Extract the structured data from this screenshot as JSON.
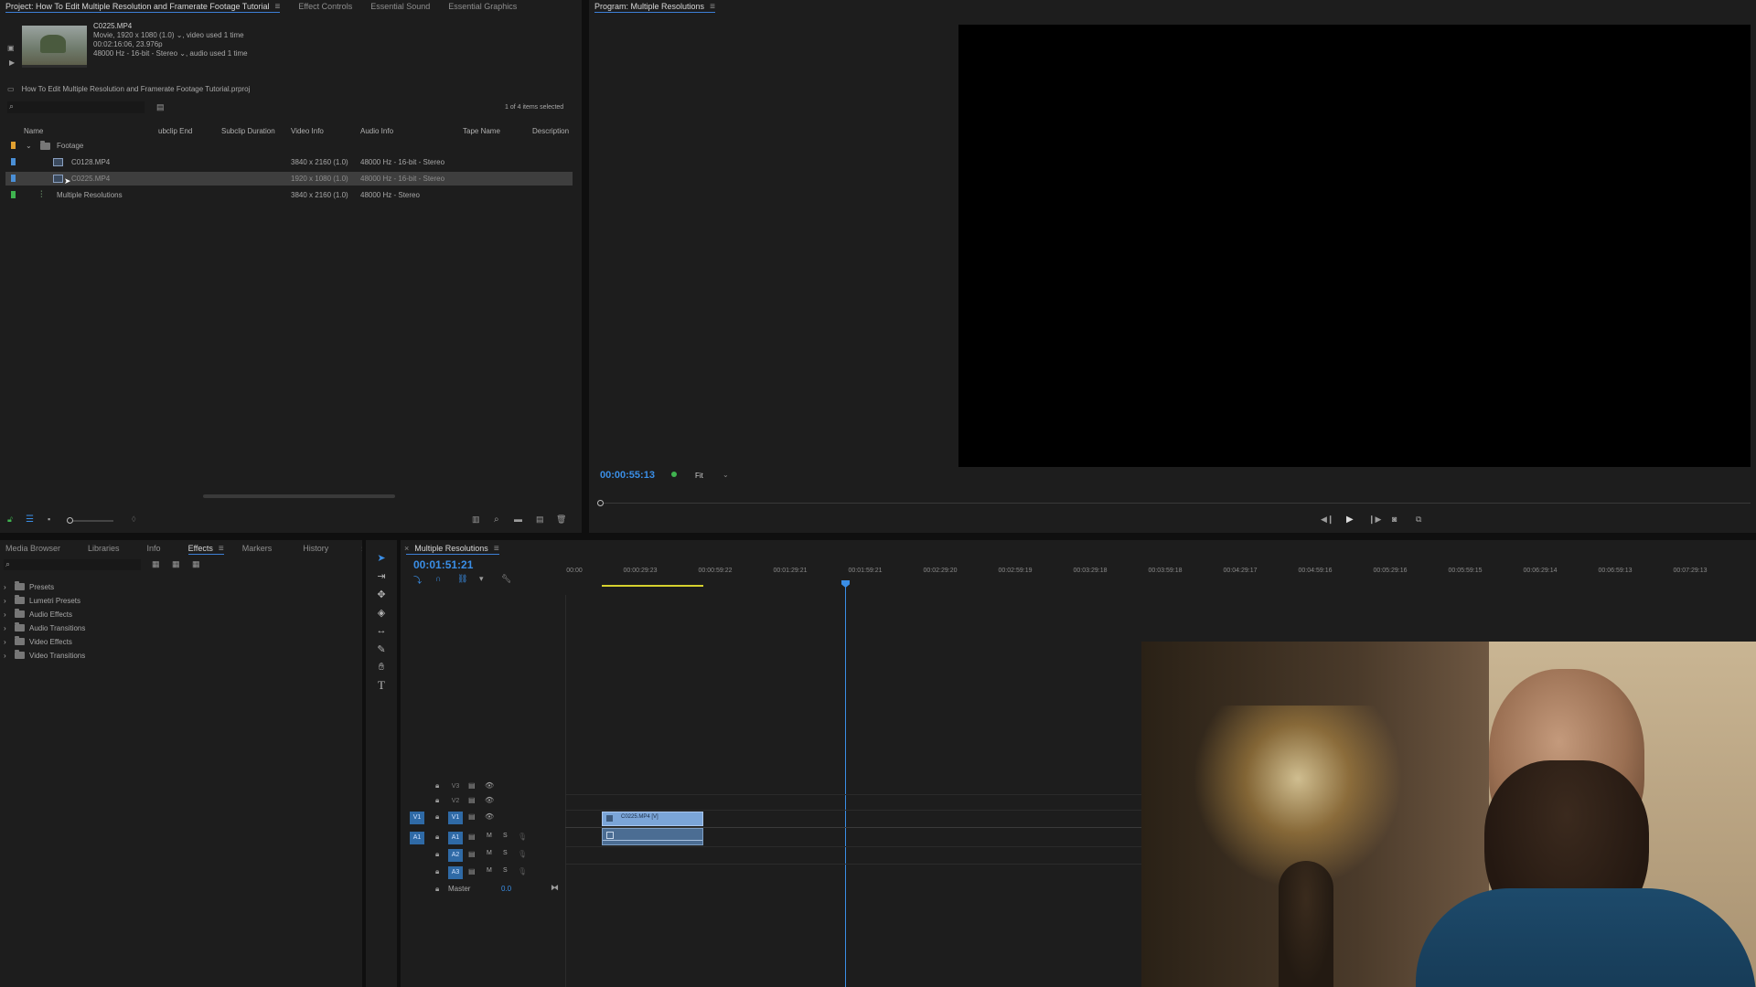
{
  "project_panel": {
    "tabs": [
      "Project: How To Edit Multiple Resolution and Framerate Footage Tutorial",
      "Effect Controls",
      "Essential Sound",
      "Essential Graphics"
    ],
    "preview": {
      "filename": "C0225.MP4",
      "line1": "Movie, 1920 x 1080 (1.0)",
      "line1_suffix": ", video used 1 time",
      "line2": "00:02:16:06, 23.976p",
      "line3": "48000 Hz - 16-bit - Stereo",
      "line3_suffix": ", audio used 1 time"
    },
    "project_file": "How To Edit Multiple Resolution and Framerate Footage Tutorial.prproj",
    "search_placeholder": "",
    "items_selected": "1 of 4 items selected",
    "columns": [
      "Name",
      "ubclip End",
      "Subclip Duration",
      "Video Info",
      "Audio Info",
      "Tape Name",
      "Description"
    ],
    "rows": [
      {
        "name": "Footage",
        "video_info": "",
        "audio_info": "",
        "color": "#e0a030",
        "type": "folder"
      },
      {
        "name": "C0128.MP4",
        "video_info": "3840 x 2160 (1.0)",
        "audio_info": "48000 Hz - 16-bit - Stereo",
        "color": "#4a8fd6",
        "type": "clip"
      },
      {
        "name": "C0225.MP4",
        "video_info": "1920 x 1080 (1.0)",
        "audio_info": "48000 Hz - 16-bit - Stereo",
        "color": "#4a8fd6",
        "type": "clip",
        "selected": true
      },
      {
        "name": "Multiple Resolutions",
        "video_info": "3840 x 2160 (1.0)",
        "audio_info": "48000 Hz - Stereo",
        "color": "#3fb34f",
        "type": "sequence"
      }
    ]
  },
  "program_monitor": {
    "title": "Program: Multiple Resolutions",
    "timecode": "00:00:55:13",
    "fit": "Fit"
  },
  "effects_panel": {
    "tabs": [
      "Media Browser",
      "Libraries",
      "Info",
      "Effects",
      "Markers",
      "History"
    ],
    "folders": [
      "Presets",
      "Lumetri Presets",
      "Audio Effects",
      "Audio Transitions",
      "Video Effects",
      "Video Transitions"
    ]
  },
  "timeline": {
    "title": "Multiple Resolutions",
    "timecode": "00:01:51:21",
    "ruler": [
      "00:00",
      "00:00:29:23",
      "00:00:59:22",
      "00:01:29:21",
      "00:01:59:21",
      "00:02:29:20",
      "00:02:59:19",
      "00:03:29:18",
      "00:03:59:18",
      "00:04:29:17",
      "00:04:59:16",
      "00:05:29:16",
      "00:05:59:15",
      "00:06:29:14",
      "00:06:59:13",
      "00:07:29:13"
    ],
    "video_tracks": [
      "V3",
      "V2",
      "V1"
    ],
    "audio_tracks": [
      "A1",
      "A2",
      "A3"
    ],
    "source_v": "V1",
    "source_a": "A1",
    "master_label": "Master",
    "master_value": "0.0",
    "clip_label": "C0225.MP4 [V]",
    "mute": "M",
    "solo": "S"
  },
  "webcam": {
    "description_color": "#2a2116"
  }
}
